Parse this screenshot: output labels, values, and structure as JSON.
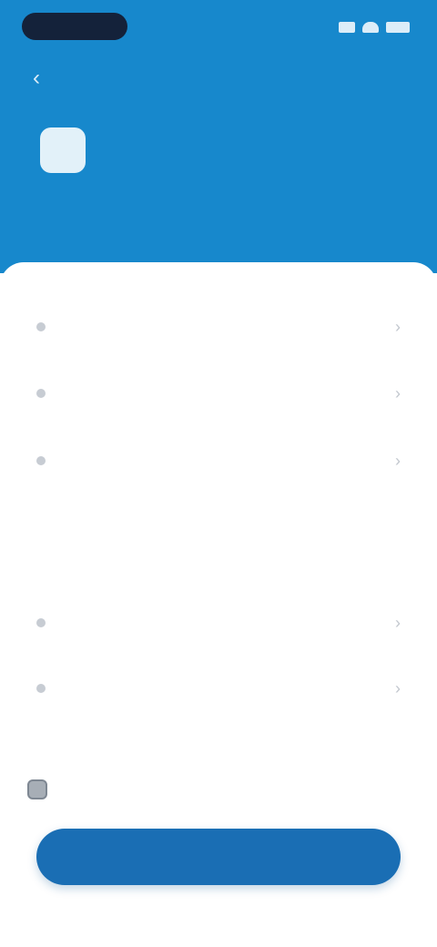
{
  "status_bar": {
    "time": ""
  },
  "nav": {
    "back_glyph": "‹",
    "title": ""
  },
  "header": {
    "description": ""
  },
  "list_group_1": [
    {
      "label": "",
      "value": ""
    },
    {
      "label": "",
      "value": ""
    },
    {
      "label": "",
      "value": ""
    }
  ],
  "section_2": {
    "title": "",
    "items": [
      {
        "label": ""
      },
      {
        "label": ""
      }
    ]
  },
  "agreement": {
    "label": ""
  },
  "primary_button": {
    "label": ""
  },
  "chevron_glyph": "›",
  "colors": {
    "header_bg": "#1788cc",
    "accent": "#2f8ad6",
    "button_bg": "#1a6eb4"
  }
}
